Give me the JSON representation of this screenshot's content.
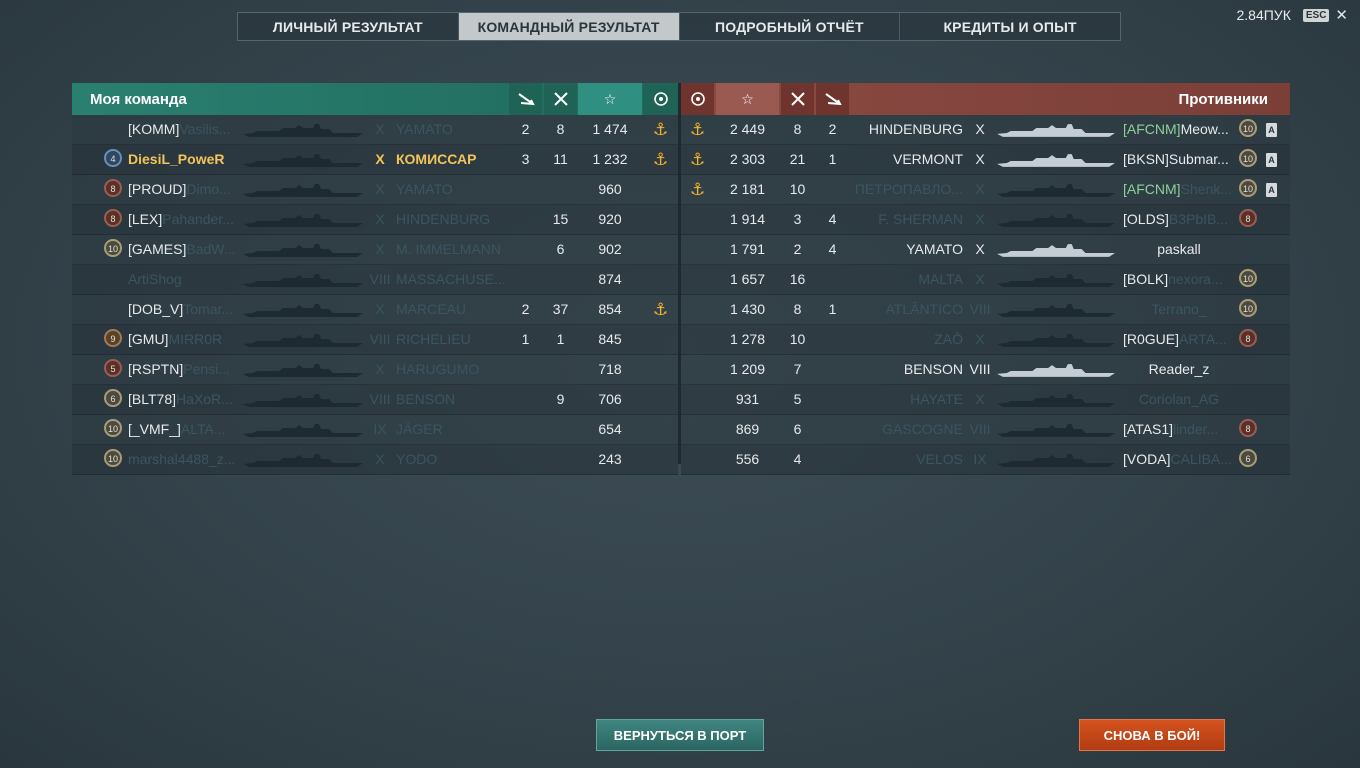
{
  "tabs": [
    {
      "label": "ЛИЧНЫЙ РЕЗУЛЬТАТ",
      "active": false
    },
    {
      "label": "КОМАНДНЫЙ РЕЗУЛЬТАТ",
      "active": true
    },
    {
      "label": "ПОДРОБНЫЙ ОТЧЁТ",
      "active": false
    },
    {
      "label": "КРЕДИТЫ И ОПЫТ",
      "active": false
    }
  ],
  "corner": {
    "value": "2.84ПУК",
    "esc_label": "ESC",
    "close_icon": "close-icon"
  },
  "left_team": {
    "title": "Моя команда",
    "header_icons": [
      "torpedo-icon",
      "crossed-swords-icon",
      "star-icon",
      "wreath-icon"
    ],
    "header_color": "#287769",
    "rows": [
      {
        "rank": "",
        "clan": "[KOMM]",
        "name": "Vasilis...",
        "tier": "X",
        "ship": "YAMATO",
        "c1": "2",
        "c2": "8",
        "xp": "1 474",
        "anchor": true,
        "style": "dim"
      },
      {
        "rank": "4",
        "clan": "",
        "name": "DiesiL_PoweR",
        "tier": "X",
        "ship": "КОМИССАР",
        "c1": "3",
        "c2": "11",
        "xp": "1 232",
        "anchor": true,
        "style": "me"
      },
      {
        "rank": "8",
        "clan": "[PROUD]",
        "name": "Dimo...",
        "tier": "X",
        "ship": "YAMATO",
        "c1": "",
        "c2": "",
        "xp": "960",
        "anchor": false,
        "style": "dim"
      },
      {
        "rank": "8",
        "clan": "[LEX]",
        "name": "Pahander...",
        "tier": "X",
        "ship": "HINDENBURG",
        "c1": "",
        "c2": "15",
        "xp": "920",
        "anchor": false,
        "style": "dim"
      },
      {
        "rank": "10",
        "clan": "[GAMES]",
        "name": "BadW...",
        "tier": "X",
        "ship": "M. IMMELMANN",
        "c1": "",
        "c2": "6",
        "xp": "902",
        "anchor": false,
        "style": "dim"
      },
      {
        "rank": "",
        "clan": "",
        "name": "ArtiShog",
        "tier": "VIII",
        "ship": "MASSACHUSE...",
        "c1": "",
        "c2": "",
        "xp": "874",
        "anchor": false,
        "style": "dim"
      },
      {
        "rank": "",
        "clan": "[DOB_V]",
        "name": "Tomar...",
        "tier": "X",
        "ship": "MARCEAU",
        "c1": "2",
        "c2": "37",
        "xp": "854",
        "anchor": true,
        "style": "dim"
      },
      {
        "rank": "9",
        "clan": "[GMU]",
        "name": "MIRR0R",
        "tier": "VIII",
        "ship": "RICHELIEU",
        "c1": "1",
        "c2": "1",
        "xp": "845",
        "anchor": false,
        "style": "dim"
      },
      {
        "rank": "5",
        "clan": "[RSPTN]",
        "name": "Pensi...",
        "tier": "X",
        "ship": "HARUGUMO",
        "c1": "",
        "c2": "",
        "xp": "718",
        "anchor": false,
        "style": "dim"
      },
      {
        "rank": "6",
        "clan": "[BLT78]",
        "name": "HaXoR...",
        "tier": "VIII",
        "ship": "BENSON",
        "c1": "",
        "c2": "9",
        "xp": "706",
        "anchor": false,
        "style": "dim"
      },
      {
        "rank": "10",
        "clan": "[_VMF_]",
        "name": "ALTA...",
        "tier": "IX",
        "ship": "JÄGER",
        "c1": "",
        "c2": "",
        "xp": "654",
        "anchor": false,
        "style": "dim"
      },
      {
        "rank": "10",
        "clan": "",
        "name": "marshal4488_z...",
        "tier": "X",
        "ship": "YODO",
        "c1": "",
        "c2": "",
        "xp": "243",
        "anchor": false,
        "style": "dim"
      }
    ]
  },
  "right_team": {
    "title": "Противники",
    "header_icons": [
      "wreath-icon",
      "star-icon",
      "crossed-swords-icon",
      "torpedo-icon"
    ],
    "header_color": "#8a4a42",
    "rows": [
      {
        "anchor": true,
        "xp": "2 449",
        "c2": "8",
        "c1": "2",
        "ship": "HINDENBURG",
        "tier": "X",
        "clan": "[AFCNM]",
        "name": "Meow...",
        "rank": "10",
        "tagA": true,
        "style": "bright",
        "clanok": true
      },
      {
        "anchor": true,
        "xp": "2 303",
        "c2": "21",
        "c1": "1",
        "ship": "VERMONT",
        "tier": "X",
        "clan": "[BKSN]",
        "name": "Submar...",
        "rank": "10",
        "tagA": true,
        "style": "bright",
        "clanok": false
      },
      {
        "anchor": true,
        "xp": "2 181",
        "c2": "10",
        "c1": "",
        "ship": "ПЕТРОПАВЛО...",
        "tier": "X",
        "clan": "[AFCNM]",
        "name": "Shenk...",
        "rank": "10",
        "tagA": true,
        "style": "dim",
        "clanok": true
      },
      {
        "anchor": false,
        "xp": "1 914",
        "c2": "3",
        "c1": "4",
        "ship": "F. SHERMAN",
        "tier": "X",
        "clan": "[OLDS]",
        "name": "B3PbIB...",
        "rank": "8",
        "tagA": false,
        "style": "dim",
        "clanok": false
      },
      {
        "anchor": false,
        "xp": "1 791",
        "c2": "2",
        "c1": "4",
        "ship": "YAMATO",
        "tier": "X",
        "clan": "",
        "name": "paskall",
        "rank": "",
        "tagA": false,
        "style": "bright",
        "clanok": false
      },
      {
        "anchor": false,
        "xp": "1 657",
        "c2": "16",
        "c1": "",
        "ship": "MALTA",
        "tier": "X",
        "clan": "[BOLK]",
        "name": "nexora...",
        "rank": "10",
        "tagA": false,
        "style": "dim",
        "clanok": false
      },
      {
        "anchor": false,
        "xp": "1 430",
        "c2": "8",
        "c1": "1",
        "ship": "ATLÂNTICO",
        "tier": "VIII",
        "clan": "",
        "name": "Terrano_",
        "rank": "10",
        "tagA": false,
        "style": "dim",
        "clanok": false
      },
      {
        "anchor": false,
        "xp": "1 278",
        "c2": "10",
        "c1": "",
        "ship": "ZAŌ",
        "tier": "X",
        "clan": "[R0GUE]",
        "name": "ARTA...",
        "rank": "8",
        "tagA": false,
        "style": "dim",
        "clanok": false
      },
      {
        "anchor": false,
        "xp": "1 209",
        "c2": "7",
        "c1": "",
        "ship": "BENSON",
        "tier": "VIII",
        "clan": "",
        "name": "Reader_z",
        "rank": "",
        "tagA": false,
        "style": "bright",
        "clanok": false
      },
      {
        "anchor": false,
        "xp": "931",
        "c2": "5",
        "c1": "",
        "ship": "HAYATE",
        "tier": "X",
        "clan": "",
        "name": "Coriolan_AG",
        "rank": "",
        "tagA": false,
        "style": "dim",
        "clanok": false
      },
      {
        "anchor": false,
        "xp": "869",
        "c2": "6",
        "c1": "",
        "ship": "GASCOGNE",
        "tier": "VIII",
        "clan": "[ATAS1]",
        "name": "linder...",
        "rank": "8",
        "tagA": false,
        "style": "dim",
        "clanok": false
      },
      {
        "anchor": false,
        "xp": "556",
        "c2": "4",
        "c1": "",
        "ship": "VELOS",
        "tier": "IX",
        "clan": "[VODA]",
        "name": "CALIBA...",
        "rank": "6",
        "tagA": false,
        "style": "dim",
        "clanok": false
      }
    ]
  },
  "buttons": {
    "return_port": "ВЕРНУТЬСЯ В ПОРТ",
    "battle_again": "СНОВА В БОЙ!"
  }
}
